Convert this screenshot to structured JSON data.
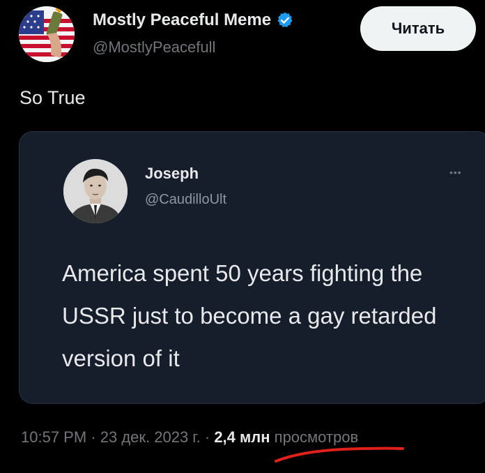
{
  "author": {
    "name": "Mostly Peaceful Meme",
    "handle": "@MostlyPeacefull",
    "follow_label": "Читать",
    "avatar_icon": "us-flag-molotov-avatar"
  },
  "tweet": {
    "text": "So True"
  },
  "quote": {
    "name": "Joseph",
    "handle": "@CaudilloUlt",
    "more_label": "•••",
    "body": "America spent 50 years fighting the USSR just to become a gay retarded version of it",
    "avatar_icon": "portrait-avatar"
  },
  "meta": {
    "time": "10:57 PM",
    "sep1": " · ",
    "date": "23 дек. 2023 г.",
    "sep2": " · ",
    "views_count": "2,4 млн",
    "views_label": " просмотров"
  },
  "colors": {
    "background": "#000000",
    "verified": "#1d9bf0",
    "quote_bg": "#161d2b",
    "annotation_red": "#e0201b"
  }
}
